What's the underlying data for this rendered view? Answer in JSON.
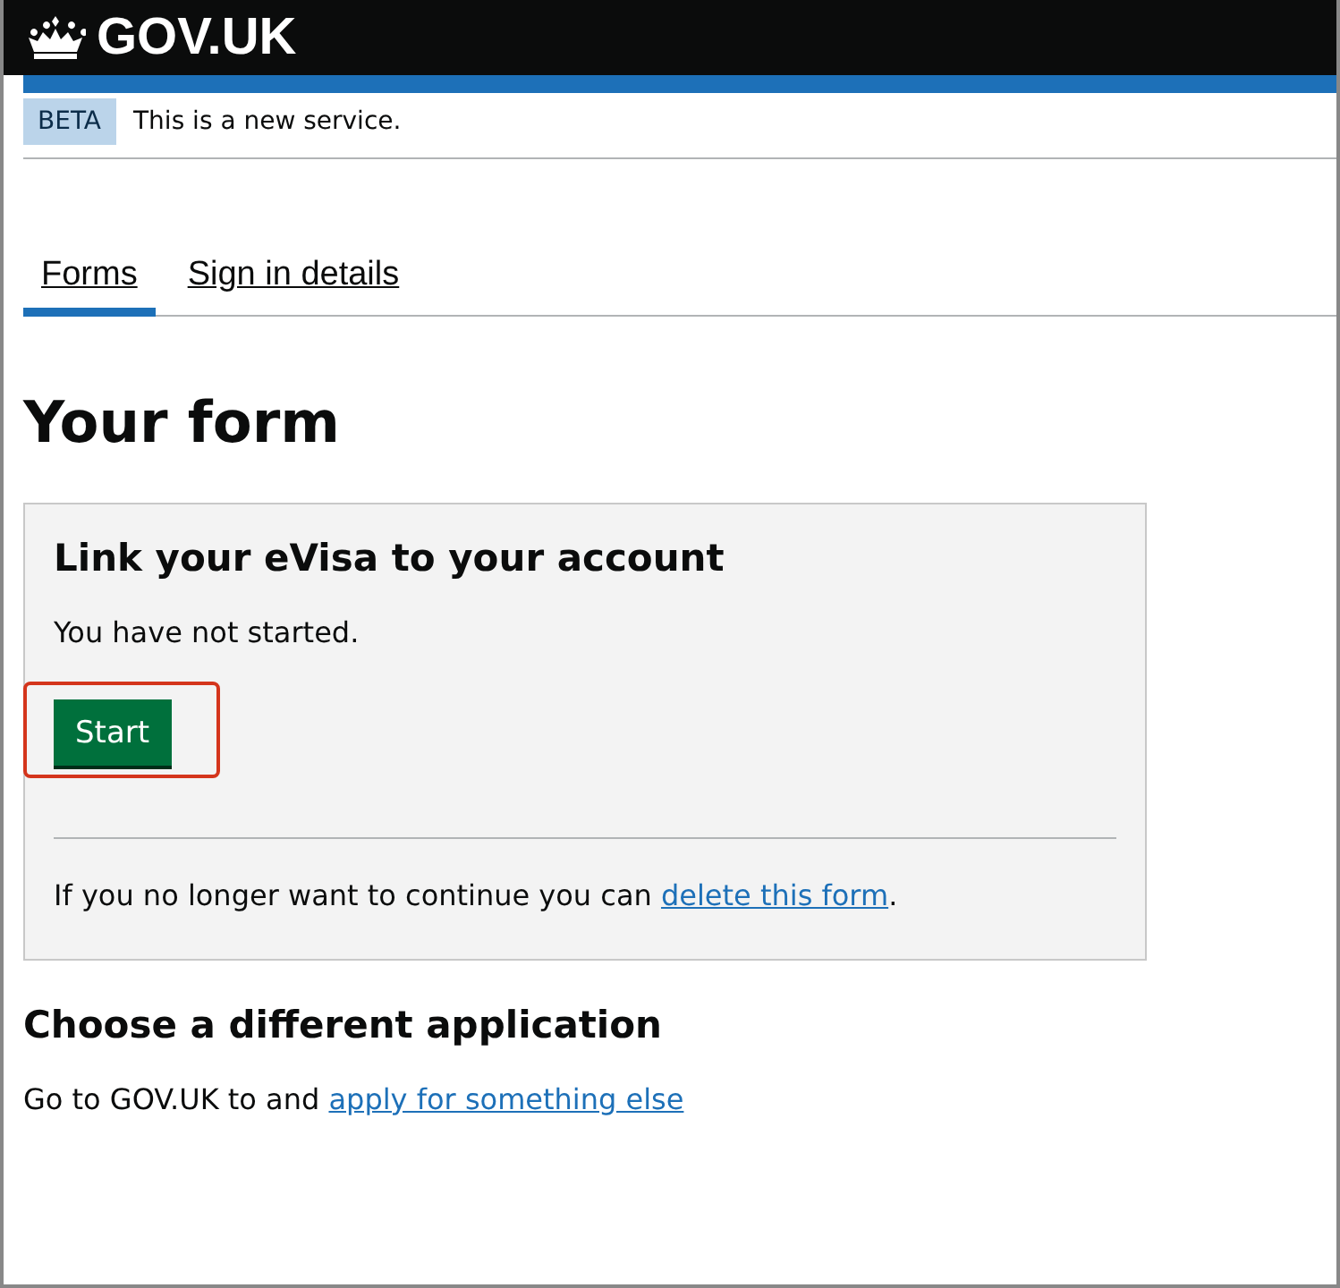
{
  "header": {
    "logo_text": "GOV.UK"
  },
  "phase_banner": {
    "tag": "BETA",
    "text": "This is a new service."
  },
  "tabs": [
    {
      "label": "Forms",
      "selected": true
    },
    {
      "label": "Sign in details",
      "selected": false
    }
  ],
  "title": "Your form",
  "card": {
    "heading": "Link your eVisa to your account",
    "status": "You have not started.",
    "button": {
      "label": "Start",
      "highlighted": true
    },
    "footer": {
      "text": "If you no longer want to continue you can ",
      "link": "delete this form",
      "after": "."
    }
  },
  "section": {
    "heading": "Choose a different application",
    "text": "Go to GOV.UK to and ",
    "link": "apply for something else"
  }
}
